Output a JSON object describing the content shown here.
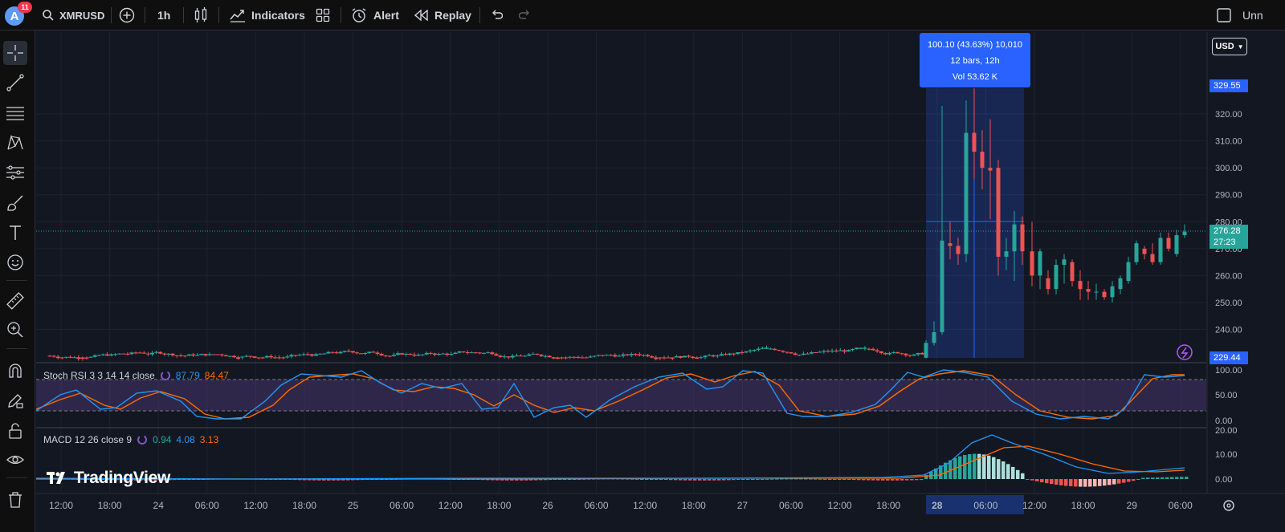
{
  "top_toolbar": {
    "avatar_letter": "A",
    "notification_count": "11",
    "symbol": "XMRUSD",
    "interval": "1h",
    "indicators_label": "Indicators",
    "alert_label": "Alert",
    "replay_label": "Replay",
    "unnamed_label": "Unn"
  },
  "currency_selector": "USD",
  "measure_tooltip": {
    "line1": "100.10 (43.63%) 10,010",
    "line2": "12 bars, 12h",
    "line3": "Vol 53.62 K"
  },
  "price_axis": {
    "ticks": [
      "320.00",
      "310.00",
      "300.00",
      "290.00",
      "280.00",
      "270.00",
      "260.00",
      "250.00",
      "240.00"
    ],
    "high_marker": "329.55",
    "low_marker": "229.44",
    "last_price": "276.28",
    "countdown": "27:23"
  },
  "stoch_rsi": {
    "label": "Stoch RSI 3 3 14 14 close",
    "k_value": "87.79",
    "d_value": "84.47",
    "axis": [
      "100.00",
      "50.00",
      "0.00"
    ]
  },
  "macd": {
    "label": "MACD 12 26 close 9",
    "hist_value": "0.94",
    "macd_value": "4.08",
    "signal_value": "3.13",
    "axis": [
      "20.00",
      "10.00",
      "0.00"
    ]
  },
  "time_axis": {
    "labels": [
      "12:00",
      "18:00",
      "24",
      "06:00",
      "12:00",
      "18:00",
      "25",
      "06:00",
      "12:00",
      "18:00",
      "26",
      "06:00",
      "12:00",
      "18:00",
      "27",
      "06:00",
      "12:00",
      "18:00",
      "28",
      "06:00",
      "12:00",
      "18:00",
      "29",
      "06:00"
    ],
    "highlighted": "28"
  },
  "watermark": "TradingView",
  "colors": {
    "up": "#26a69a",
    "down": "#ef5350",
    "accent": "#2962ff",
    "stoch_k": "#2196f3",
    "stoch_d": "#ff6d00",
    "stoch_band": "#7e57c2"
  }
}
